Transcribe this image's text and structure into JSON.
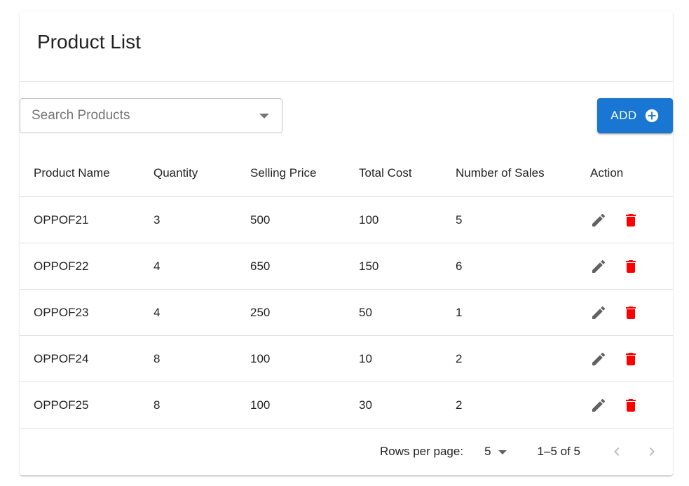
{
  "header": {
    "title": "Product List"
  },
  "search": {
    "placeholder": "Search Products",
    "value": ""
  },
  "toolbar": {
    "add_label": "ADD",
    "accent": "#1976d2"
  },
  "table": {
    "columns": [
      "Product Name",
      "Quantity",
      "Selling Price",
      "Total Cost",
      "Number of Sales",
      "Action"
    ],
    "rows": [
      {
        "name": "OPPOF21",
        "quantity": "3",
        "price": "500",
        "cost": "100",
        "sales": "5"
      },
      {
        "name": "OPPOF22",
        "quantity": "4",
        "price": "650",
        "cost": "150",
        "sales": "6"
      },
      {
        "name": "OPPOF23",
        "quantity": "4",
        "price": "250",
        "cost": "50",
        "sales": "1"
      },
      {
        "name": "OPPOF24",
        "quantity": "8",
        "price": "100",
        "cost": "10",
        "sales": "2"
      },
      {
        "name": "OPPOF25",
        "quantity": "8",
        "price": "100",
        "cost": "30",
        "sales": "2"
      }
    ],
    "actions": {
      "edit_icon": "pencil-icon",
      "delete_icon": "trash-icon",
      "edit_color": "#616161",
      "delete_color": "#ff0000"
    }
  },
  "pagination": {
    "rows_per_page_label": "Rows per page:",
    "rows_per_page_value": "5",
    "range_label": "1–5 of 5"
  }
}
